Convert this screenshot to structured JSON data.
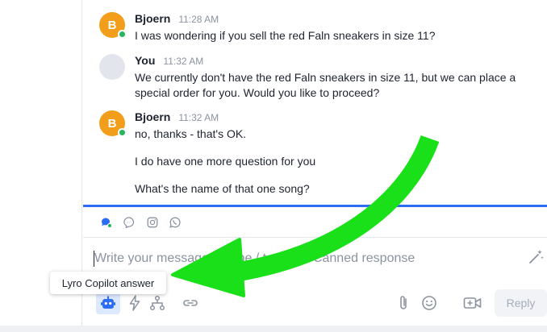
{
  "messages": [
    {
      "avatar_letter": "B",
      "author": "Bjoern",
      "time": "11:28 AM",
      "lines": [
        "I was wondering if you sell the red Faln sneakers in size 11?"
      ]
    },
    {
      "avatar_letter": "",
      "author": "You",
      "time": "11:32 AM",
      "lines": [
        "We currently don't have the red Faln sneakers in size 11, but we can place a special order for you. Would you like to proceed?"
      ]
    },
    {
      "avatar_letter": "B",
      "author": "Bjoern",
      "time": "11:32 AM",
      "lines": [
        "no, thanks - that's OK.",
        "I do have one more question for you",
        "What's the name of that one song?"
      ]
    }
  ],
  "composer": {
    "placeholder": "Write your message or type / to add a Canned response"
  },
  "toolbar": {
    "tooltip": "Lyro Copilot answer",
    "reply_label": "Reply"
  },
  "icons": {
    "channels": [
      "livechat-icon",
      "messenger-icon",
      "instagram-icon",
      "whatsapp-icon"
    ],
    "toolbar_left": [
      "lyro-bot-icon",
      "lightning-icon",
      "flow-icon",
      "link-icon"
    ],
    "toolbar_right": [
      "paperclip-icon",
      "emoji-icon",
      "video-icon"
    ],
    "composer": "magic-wand-icon"
  },
  "colors": {
    "accent": "#2d6cf6",
    "avatar_orange": "#f29e1a",
    "online": "#27b560",
    "annotation_arrow": "#19e019"
  }
}
